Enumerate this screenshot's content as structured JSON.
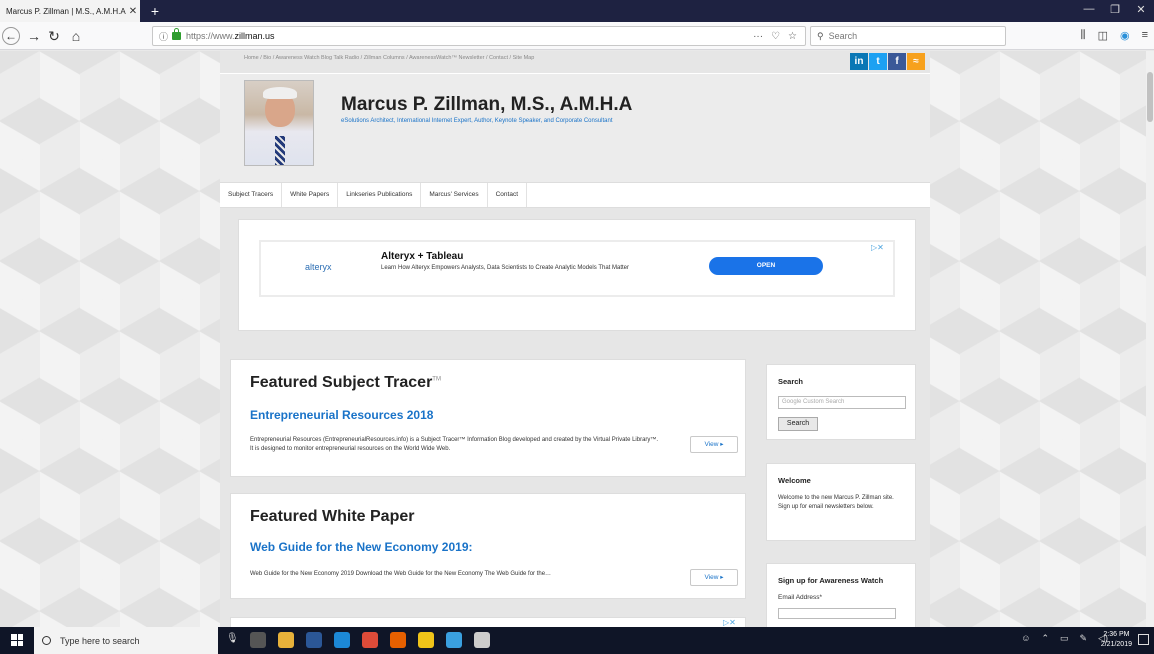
{
  "browser": {
    "tab_title": "Marcus P. Zillman | M.S., A.M.H.A.",
    "tab_close": "✕",
    "new_tab": "+",
    "url_prefix": "https://www.",
    "url_host": "zillman.us",
    "search_placeholder": "Search",
    "url_actions": [
      "···",
      "♡",
      "☆"
    ]
  },
  "site": {
    "utility_nav": "Home / Bio / Awareness Watch Blog Talk Radio / Zillman Columns / AwarenessWatch™ Newsletter / Contact / Site Map",
    "social": {
      "linkedin": "in",
      "twitter": "t",
      "facebook": "f",
      "rss": "≈"
    },
    "title": "Marcus P. Zillman, M.S., A.M.H.A",
    "tagline": "eSolutions Architect, International Internet Expert, Author, Keynote Speaker, and Corporate Consultant",
    "nav": [
      "Subject Tracers",
      "White Papers",
      "Linkseries Publications",
      "Marcus' Services",
      "Contact"
    ]
  },
  "ad": {
    "logo": "alteryx",
    "title": "Alteryx + Tableau",
    "text": "Learn How Alteryx Empowers Analysts, Data Scientists to Create Analytic Models That Matter",
    "button": "OPEN",
    "choice": "▷✕"
  },
  "featured_tracer": {
    "heading": "Featured Subject Tracer",
    "tm": "TM",
    "title": "Entrepreneurial Resources 2018",
    "text": "Entrepreneurial Resources (EntrepreneurialResources.info) is a Subject Tracer™ Information Blog developed and created by the Virtual Private Library™. It is designed to monitor entrepreneurial resources on the World Wide Web.",
    "view": "View ▸"
  },
  "featured_paper": {
    "heading": "Featured White Paper",
    "title": "Web Guide for the New Economy 2019:",
    "text": "Web Guide for the New Economy 2019 Download the Web Guide for the New Economy The Web Guide for the…",
    "view": "View ▸"
  },
  "sidebar": {
    "search_title": "Search",
    "search_placeholder": "Google Custom Search",
    "search_button": "Search",
    "welcome_title": "Welcome",
    "welcome_text": "Welcome to the new Marcus P. Zillman site. Sign up for email newsletters below.",
    "signup_title": "Sign up for Awareness Watch",
    "email_label": "Email Address*"
  },
  "taskbar": {
    "search_text": "Type here to search",
    "time": "2:36 PM",
    "date": "2/21/2019"
  },
  "colors": {
    "title_bar": "#1e2241",
    "link_blue": "#1a73c8",
    "ad_button": "#1a73e8",
    "taskbar": "#0f1527"
  }
}
